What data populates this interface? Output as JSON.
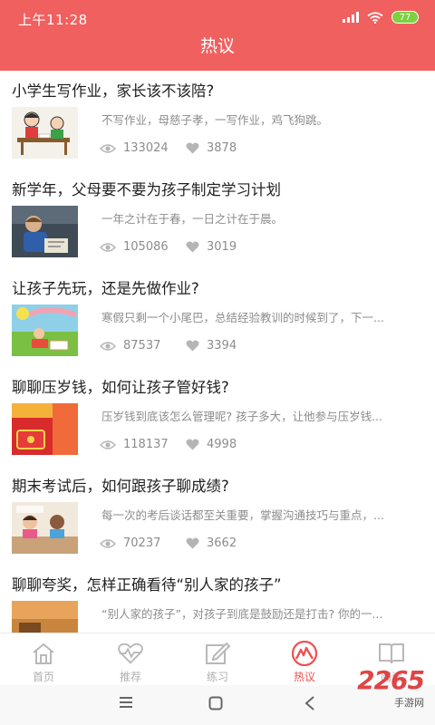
{
  "status_bar": {
    "time": "上午11:28",
    "battery": "77"
  },
  "header": {
    "title": "热议"
  },
  "articles": [
    {
      "title": "小学生写作业，家长该不该陪?",
      "summary": "不写作业，母慈子孝，一写作业，鸡飞狗跳。",
      "views": "133024",
      "likes": "3878"
    },
    {
      "title": "新学年，父母要不要为孩子制定学习计划",
      "summary": "一年之计在于春，一日之计在于晨。",
      "views": "105086",
      "likes": "3019"
    },
    {
      "title": "让孩子先玩，还是先做作业?",
      "summary": "寒假只剩一个小尾巴，总结经验教训的时候到了，下一...",
      "views": "87537",
      "likes": "3394"
    },
    {
      "title": "聊聊压岁钱，如何让孩子管好钱?",
      "summary": "压岁钱到底该怎么管理呢? 孩子多大，让他参与压岁钱...",
      "views": "118137",
      "likes": "4998"
    },
    {
      "title": "期末考试后，如何跟孩子聊成绩?",
      "summary": "每一次的考后谈话都至关重要，掌握沟通技巧与重点，...",
      "views": "70237",
      "likes": "3662"
    },
    {
      "title": "聊聊夸奖，怎样正确看待“别人家的孩子”",
      "summary": "“别人家的孩子”，对孩子到底是鼓励还是打击? 你的一...",
      "views": "",
      "likes": ""
    }
  ],
  "tabs": [
    {
      "label": "首页",
      "icon": "home-icon"
    },
    {
      "label": "推荐",
      "icon": "heartbeat-icon"
    },
    {
      "label": "练习",
      "icon": "edit-icon"
    },
    {
      "label": "热议",
      "icon": "hot-topic-icon"
    },
    {
      "label": "阅读",
      "icon": "book-icon"
    }
  ],
  "active_tab": "热议",
  "watermark": {
    "brand": "2265",
    "sub": "手游网"
  },
  "colors": {
    "brand_red": "#f0605f",
    "active_tab": "#ef5150",
    "muted_text": "#8c8c8c"
  }
}
